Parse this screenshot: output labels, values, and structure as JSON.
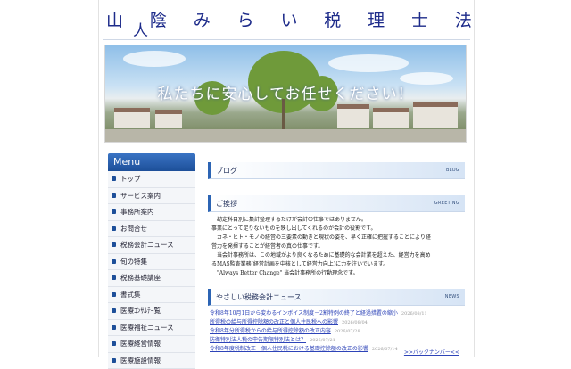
{
  "site": {
    "title_chars": [
      "山",
      "陰",
      "み",
      "ら",
      "い",
      "税",
      "理",
      "士",
      "法"
    ],
    "title_overlay_char": "人"
  },
  "hero": {
    "text": "私たちに安心してお任せください！"
  },
  "menu": {
    "heading": "Menu",
    "items": [
      {
        "label": "トップ"
      },
      {
        "label": "サービス案内"
      },
      {
        "label": "事務所案内"
      },
      {
        "label": "お問合せ"
      },
      {
        "label": "税務会計ニュース"
      },
      {
        "label": "旬の特集"
      },
      {
        "label": "税務基礎講座"
      },
      {
        "label": "書式集"
      },
      {
        "label": "医療ｺﾝｻﾙﾃｰ覧"
      },
      {
        "label": "医療福祉ニュース"
      },
      {
        "label": "医療経営情報"
      },
      {
        "label": "医療施設情報"
      }
    ]
  },
  "sections": {
    "blog": {
      "title": "ブログ",
      "en": "BLOG"
    },
    "greeting": {
      "title": "ご挨拶",
      "en": "GREETING",
      "paragraphs": [
        "　勘定科目別に集計整理するだけが会計の仕事ではありません。",
        "事業にとって足りないものを映し出してくれるのが会計の役割です。",
        "　カネ・ヒト・モノの経営の三要素の動きと現状の姿を、早く正確に把握することにより経",
        "営力を発揮することが経営者の真の仕事です。",
        "　当会計事務所は、この地域がより良くなるために基礎的な会計業を超えた、経営力を高め",
        "るMAS監査業務(経営計画を中核として経営力向上)に力を注いでいます。",
        "　\"Always Better Change\" 当会計事務所の行動理念です。"
      ]
    },
    "news": {
      "title": "やさしい税務会計ニュース",
      "en": "NEWS",
      "items": [
        {
          "title": "令和8年10月1日から変わるインボイス制度－2割特例の終了と経過措置の縮小",
          "date": "2026/08/11"
        },
        {
          "title": "所得税の給与所得控除額の改正と個人住民税への影響",
          "date": "2026/08/04"
        },
        {
          "title": "令和8年分所得税からの給与所得控除額の改正内容",
          "date": "2026/07/28"
        },
        {
          "title": "防衛特別法人税の申告期限特別法とは？",
          "date": "2026/07/21"
        },
        {
          "title": "令和8年度税制改正－個人住民税における基礎控除額の改正の影響",
          "date": "2026/07/14"
        }
      ],
      "backnumber": ">>バックナンバー<<"
    }
  }
}
